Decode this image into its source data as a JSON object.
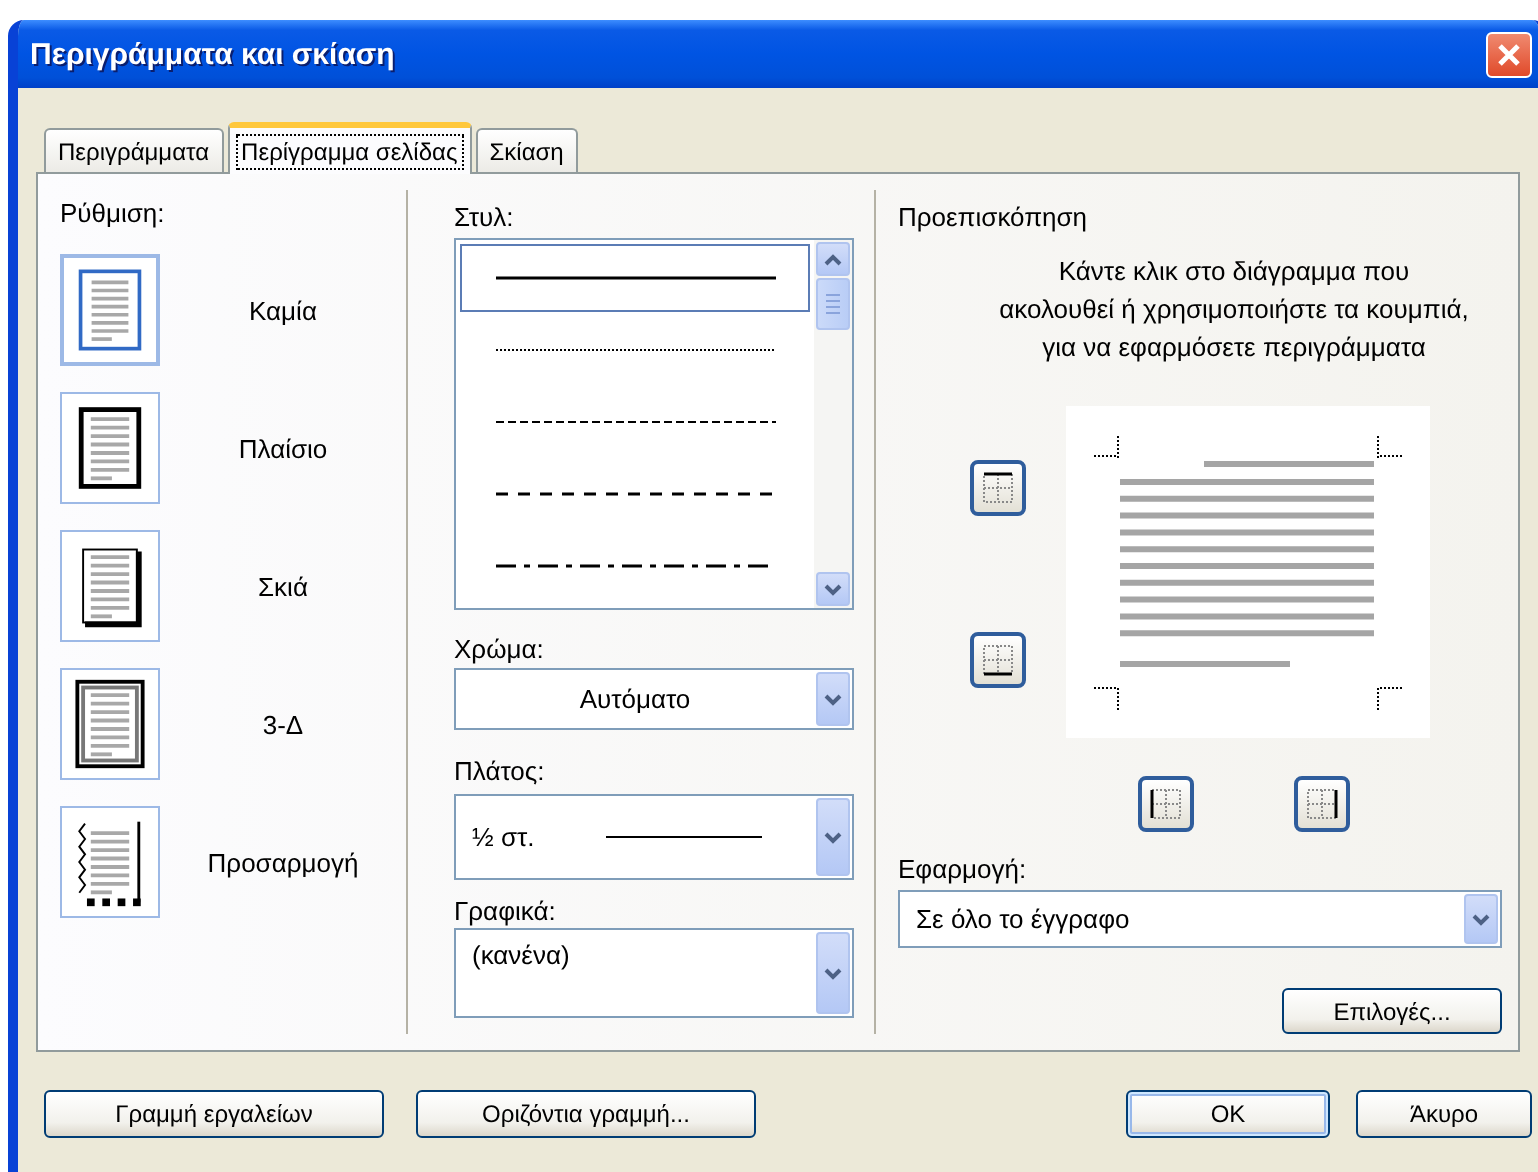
{
  "window": {
    "title": "Περιγράμματα και σκίαση"
  },
  "tabs": [
    {
      "label": "Περιγράμματα",
      "selected": false
    },
    {
      "label": "Περίγραμμα σελίδας",
      "selected": true
    },
    {
      "label": "Σκίαση",
      "selected": false
    }
  ],
  "setting": {
    "label": "Ρύθμιση:",
    "options": [
      {
        "label": "Καμία",
        "kind": "none",
        "selected": true
      },
      {
        "label": "Πλαίσιο",
        "kind": "box",
        "selected": false
      },
      {
        "label": "Σκιά",
        "kind": "shadow",
        "selected": false
      },
      {
        "label": "3-Δ",
        "kind": "three_d",
        "selected": false
      },
      {
        "label": "Προσαρμογή",
        "kind": "custom",
        "selected": false
      }
    ]
  },
  "style": {
    "label": "Στυλ:",
    "lines": [
      {
        "kind": "solid",
        "selected": true
      },
      {
        "kind": "dotted",
        "selected": false
      },
      {
        "kind": "dashed",
        "selected": false
      },
      {
        "kind": "dashed_wide",
        "selected": false
      },
      {
        "kind": "dash_dot",
        "selected": false
      }
    ]
  },
  "color": {
    "label": "Χρώμα:",
    "value": "Αυτόματο"
  },
  "width": {
    "label": "Πλάτος:",
    "value": "½ στ."
  },
  "art": {
    "label": "Γραφικά:",
    "value": "(κανένα)"
  },
  "preview": {
    "title": "Προεπισκόπηση",
    "hint": "Κάντε κλικ στο διάγραμμα που\nακολουθεί ή χρησιμοποιήστε τα κουμπιά,\nγια να εφαρμόσετε περιγράμματα",
    "apply_label": "Εφαρμογή:",
    "apply_value": "Σε όλο το έγγραφο",
    "options_button": "Επιλογές..."
  },
  "footer": {
    "left": [
      {
        "label": "Γραμμή εργαλείων",
        "default": false
      },
      {
        "label": "Οριζόντια γραμμή...",
        "default": false
      }
    ],
    "right": [
      {
        "label": "OK",
        "default": true
      },
      {
        "label": "Άκυρο",
        "default": false
      }
    ]
  }
}
